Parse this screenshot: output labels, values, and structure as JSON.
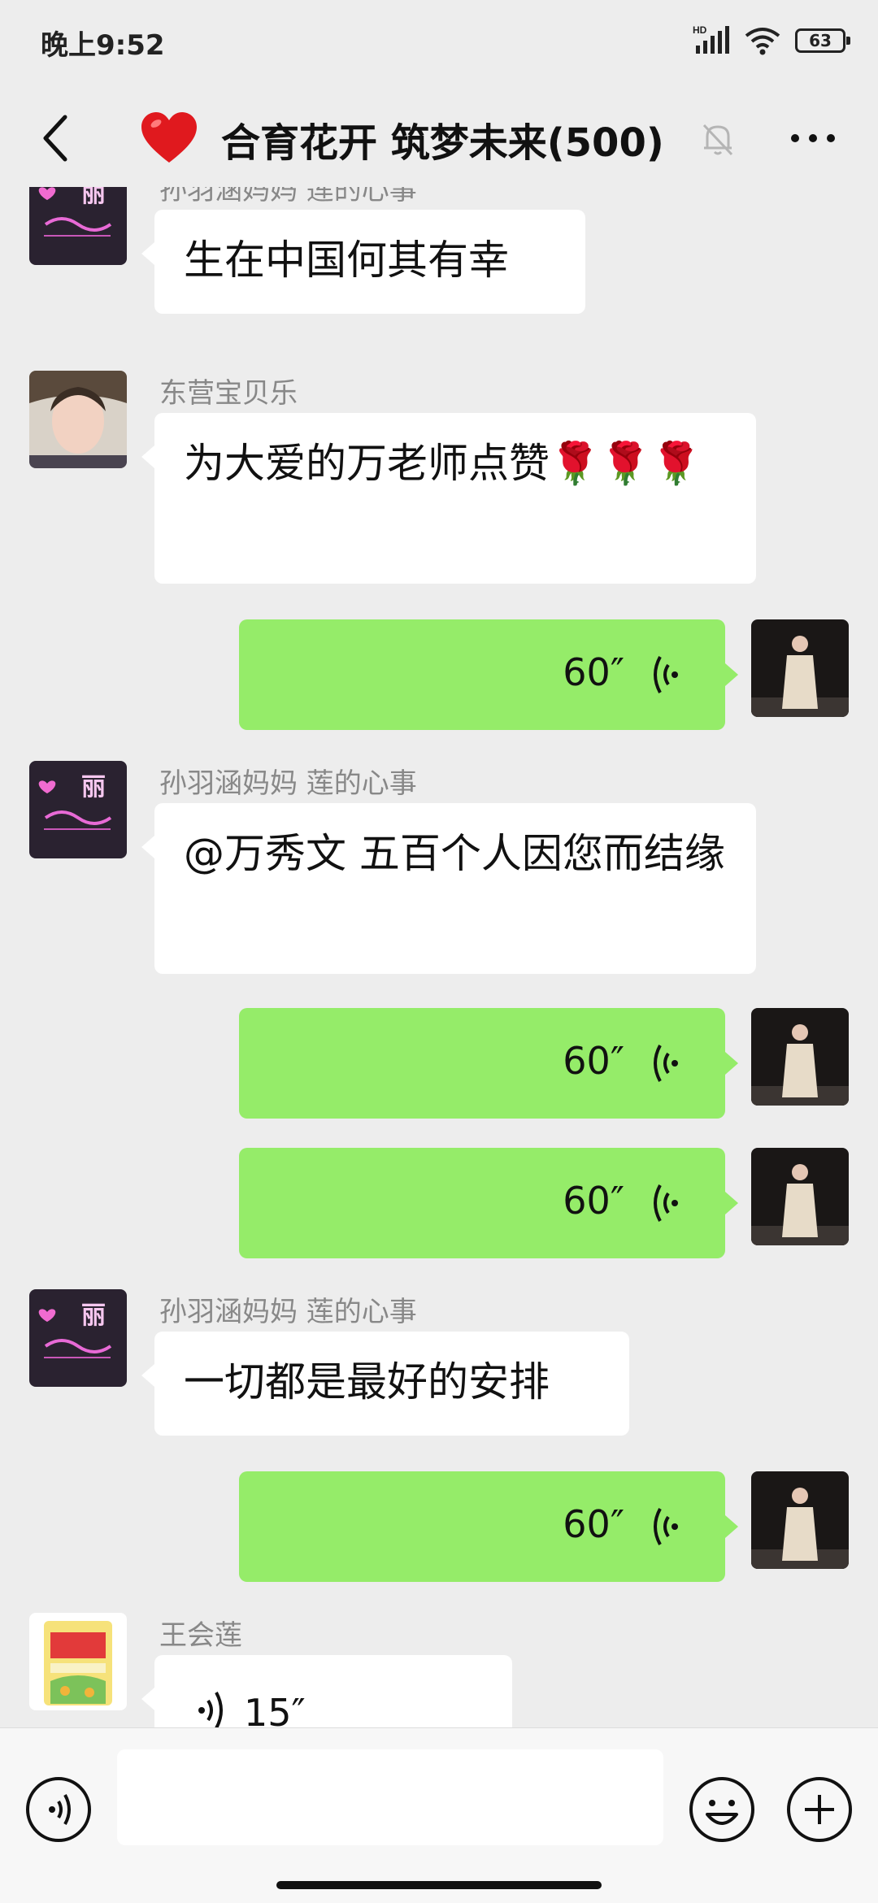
{
  "status_bar": {
    "time": "晚上9:52",
    "network_label": "HD",
    "battery": "63",
    "icons": [
      "signal-icon",
      "wifi-icon",
      "battery-icon"
    ]
  },
  "header": {
    "title": "合育花开 筑梦未来(500)",
    "icons": [
      "back-icon",
      "heart-icon",
      "mute-bell-icon",
      "more-icon"
    ]
  },
  "messages": [
    {
      "type": "text",
      "side": "left",
      "sender": "孙羽涵妈妈   莲的心事",
      "text": "生在中国何其有幸"
    },
    {
      "type": "text",
      "side": "left",
      "sender": "东营宝贝乐",
      "text": "为大爱的万老师点赞🌹🌹🌹"
    },
    {
      "type": "voice",
      "side": "right",
      "duration": "60″"
    },
    {
      "type": "text",
      "side": "left",
      "sender": "孙羽涵妈妈   莲的心事",
      "text": "@万秀文  五百个人因您而结缘"
    },
    {
      "type": "voice",
      "side": "right",
      "duration": "60″"
    },
    {
      "type": "voice",
      "side": "right",
      "duration": "60″"
    },
    {
      "type": "text",
      "side": "left",
      "sender": "孙羽涵妈妈   莲的心事",
      "text": "一切都是最好的安排"
    },
    {
      "type": "voice",
      "side": "right",
      "duration": "60″"
    },
    {
      "type": "voice",
      "side": "left",
      "sender": "王会莲",
      "duration": "15″"
    }
  ],
  "avatar_texts": {
    "neon_sign": "丽"
  },
  "input_bar": {
    "placeholder": "",
    "icons": [
      "voice-input-icon",
      "emoji-icon",
      "plus-icon"
    ]
  },
  "colors": {
    "background": "#ededed",
    "my_bubble": "#95ec69",
    "their_bubble": "#ffffff",
    "sender_name": "#888888"
  }
}
